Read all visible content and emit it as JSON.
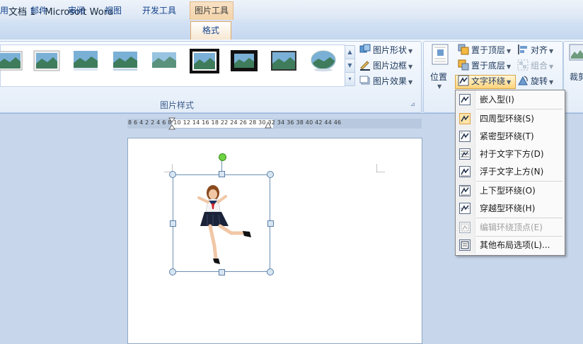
{
  "window": {
    "title": "文档 1 - Microsoft Word",
    "context_tab_group": "图片工具"
  },
  "tabs": [
    {
      "label": "用"
    },
    {
      "label": "邮件"
    },
    {
      "label": "审阅"
    },
    {
      "label": "视图"
    },
    {
      "label": "开发工具"
    },
    {
      "label": "格式",
      "active": true
    }
  ],
  "ribbon": {
    "styles_group": {
      "label": "图片样式",
      "picture_shape": "图片形状",
      "picture_border": "图片边框",
      "picture_effects": "图片效果"
    },
    "arrange_group": {
      "position": "位置",
      "bring_to_front": "置于顶层",
      "send_to_back": "置于底层",
      "text_wrapping": "文字环绕",
      "align": "对齐",
      "group": "组合",
      "rotate": "旋转"
    },
    "size_group": {
      "crop": "裁剪"
    }
  },
  "ruler": {
    "text": "8  6  4  2       2  4  6  8  10  12  14  16  18      22  24  26  28  30  32  34  36  38  40  42  44  46"
  },
  "wrap_menu": {
    "items": [
      {
        "label": "嵌入型(I)",
        "icon": "inline-wrap-icon",
        "checked": false,
        "disabled": false
      },
      {
        "label": "四周型环绕(S)",
        "icon": "square-wrap-icon",
        "checked": true,
        "disabled": false
      },
      {
        "label": "紧密型环绕(T)",
        "icon": "tight-wrap-icon",
        "checked": false,
        "disabled": false
      },
      {
        "label": "衬于文字下方(D)",
        "icon": "behind-text-icon",
        "checked": false,
        "disabled": false
      },
      {
        "label": "浮于文字上方(N)",
        "icon": "in-front-of-text-icon",
        "checked": false,
        "disabled": false
      },
      {
        "label": "上下型环绕(O)",
        "icon": "top-bottom-wrap-icon",
        "checked": false,
        "disabled": false
      },
      {
        "label": "穿越型环绕(H)",
        "icon": "through-wrap-icon",
        "checked": false,
        "disabled": false
      },
      {
        "label": "编辑环绕顶点(E)",
        "icon": "edit-wrap-points-icon",
        "checked": false,
        "disabled": true
      },
      {
        "label": "其他布局选项(L)...",
        "icon": "more-layout-options-icon",
        "checked": false,
        "disabled": false
      }
    ]
  }
}
